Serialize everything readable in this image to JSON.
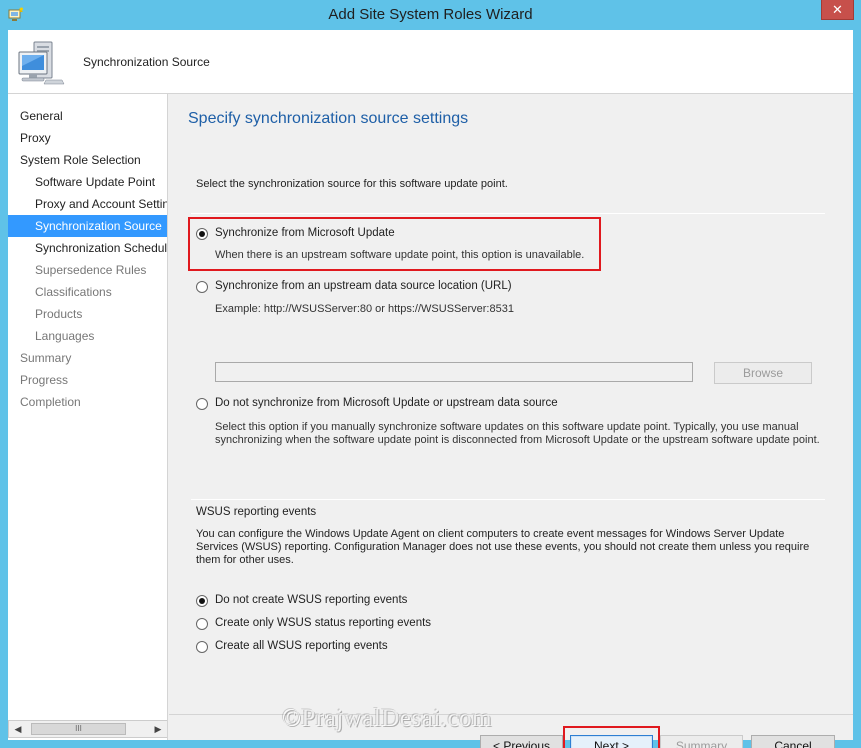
{
  "window": {
    "title": "Add Site System Roles Wizard",
    "close_label": "✕"
  },
  "header": {
    "title": "Synchronization Source"
  },
  "nav": {
    "items": [
      {
        "label": "General"
      },
      {
        "label": "Proxy"
      },
      {
        "label": "System Role Selection"
      },
      {
        "label": "Software Update Point"
      },
      {
        "label": "Proxy and Account Settings"
      },
      {
        "label": "Synchronization Source"
      },
      {
        "label": "Synchronization Schedule"
      },
      {
        "label": "Supersedence Rules"
      },
      {
        "label": "Classifications"
      },
      {
        "label": "Products"
      },
      {
        "label": "Languages"
      },
      {
        "label": "Summary"
      },
      {
        "label": "Progress"
      },
      {
        "label": "Completion"
      }
    ],
    "scroll_left": "◀",
    "scroll_right": "▶",
    "scroll_thumb": "III"
  },
  "content": {
    "heading": "Specify synchronization source settings",
    "intro": "Select the synchronization source for this software update point.",
    "options": {
      "microsoft_update": {
        "label": "Synchronize from Microsoft Update",
        "note": "When there is an upstream software update point, this option is unavailable.",
        "selected": true
      },
      "upstream": {
        "label": "Synchronize from an upstream data source location (URL)",
        "example": "Example: http://WSUSServer:80 or https://WSUSServer:8531",
        "url_value": "",
        "browse_label": "Browse"
      },
      "none": {
        "label": "Do not synchronize from Microsoft Update or upstream data source",
        "note": "Select this option if you manually synchronize software updates on this software update point. Typically, you use manual synchronizing when the software update point is disconnected from Microsoft Update or the upstream software update point."
      }
    },
    "reporting": {
      "title": "WSUS reporting events",
      "description": "You can configure the Windows Update Agent on client computers to create event messages for Windows Server Update Services (WSUS) reporting. Configuration Manager does not use these events, you should not create them unless you require them for other uses.",
      "options": [
        {
          "label": "Do not create WSUS reporting events",
          "selected": true
        },
        {
          "label": "Create only WSUS status reporting events",
          "selected": false
        },
        {
          "label": "Create all WSUS reporting events",
          "selected": false
        }
      ]
    }
  },
  "footer": {
    "previous_label": "< Previous",
    "next_label": "Next >",
    "summary_label": "Summary",
    "cancel_label": "Cancel"
  },
  "watermark": "©PrajwalDesai.com",
  "colors": {
    "title_bar": "#5fc2e8",
    "selection": "#3399ff",
    "heading": "#1e5fa7",
    "highlight": "#e0191e",
    "close_button": "#c7504b"
  }
}
